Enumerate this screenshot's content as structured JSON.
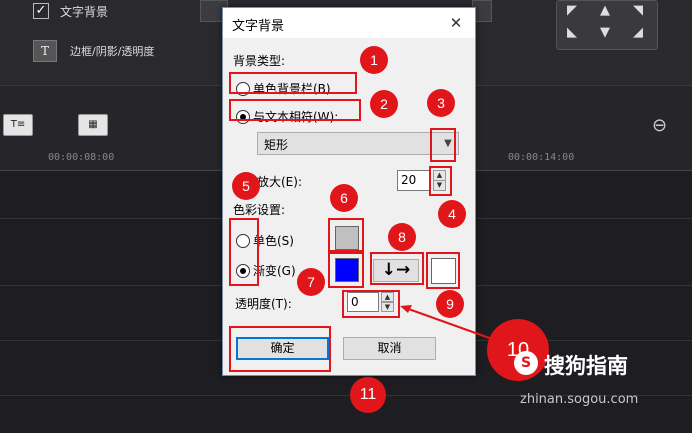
{
  "app": {
    "text_bg_label": "文字背景",
    "border_label": "边框/阴影/透明度",
    "t_icon_glyph": "T",
    "check_glyph": "✓",
    "toolbar_icon1": "T≡",
    "ruler_ticks": [
      "00:00:08:00",
      "00:00:14:00"
    ]
  },
  "dialog": {
    "title": "文字背景",
    "close_glyph": "✕",
    "bg_type_label": "背景类型:",
    "radio_single_bar": "单色背景栏(B)",
    "radio_fit_text": "与文本相符(W):",
    "shape_value": "矩形",
    "expand_label": "放大(E):",
    "expand_value": "20",
    "color_settings_label": "色彩设置:",
    "radio_single_color": "单色(S)",
    "radio_gradient": "渐变(G)",
    "gradient_direction_glyph": "↓→",
    "opacity_label": "透明度(T):",
    "opacity_value": "0",
    "ok_label": "确定",
    "cancel_label": "取消",
    "swatch_colors": {
      "single": "#c0c0c0",
      "gradient_start": "#0000ff",
      "gradient_end": "#ffffff"
    }
  },
  "annotations": [
    "1",
    "2",
    "3",
    "4",
    "5",
    "6",
    "7",
    "8",
    "9",
    "10",
    "11"
  ],
  "watermark": {
    "logo": "搜狗指南",
    "url": "zhinan.sogou.com"
  }
}
